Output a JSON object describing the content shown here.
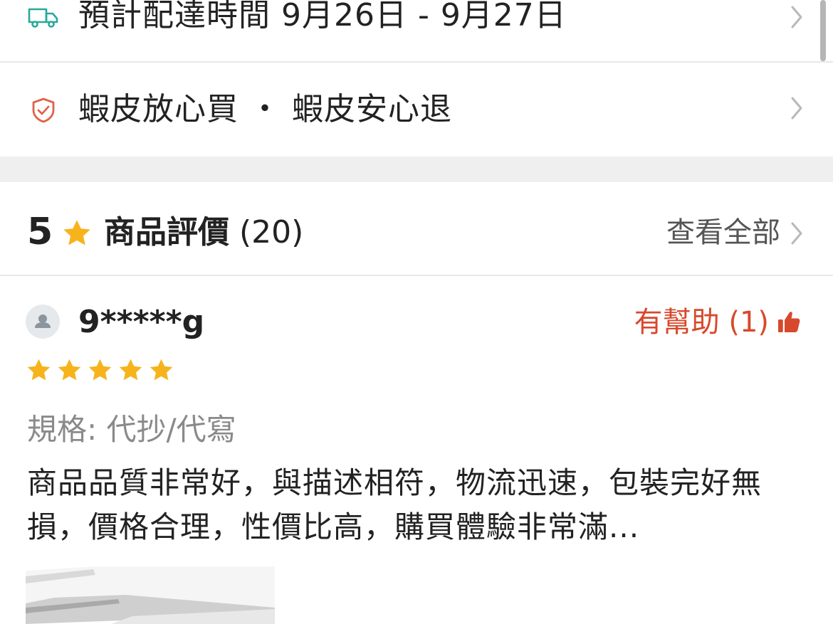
{
  "delivery": {
    "icon": "truck-icon",
    "label": "預計配達時間 9月26日 - 9月27日"
  },
  "guarantee": {
    "icon": "shield-check-icon",
    "label": "蝦皮放心買 ・ 蝦皮安心退"
  },
  "reviews_header": {
    "score": "5",
    "title": "商品評價",
    "count": "(20)",
    "view_all": "查看全部"
  },
  "review": {
    "username": "9*****g",
    "helpful_label": "有幫助 (1)",
    "stars": 5,
    "variation": "規格: 代抄/代寫",
    "body": "商品品質非常好，與描述相符，物流迅速，包裝完好無損，價格合理，性價比高，購買體驗非常滿..."
  },
  "colors": {
    "accent_orange": "#d7492c",
    "star_yellow": "#f6b31b",
    "icon_teal": "#26aa99",
    "separator_gray": "#efefef"
  }
}
